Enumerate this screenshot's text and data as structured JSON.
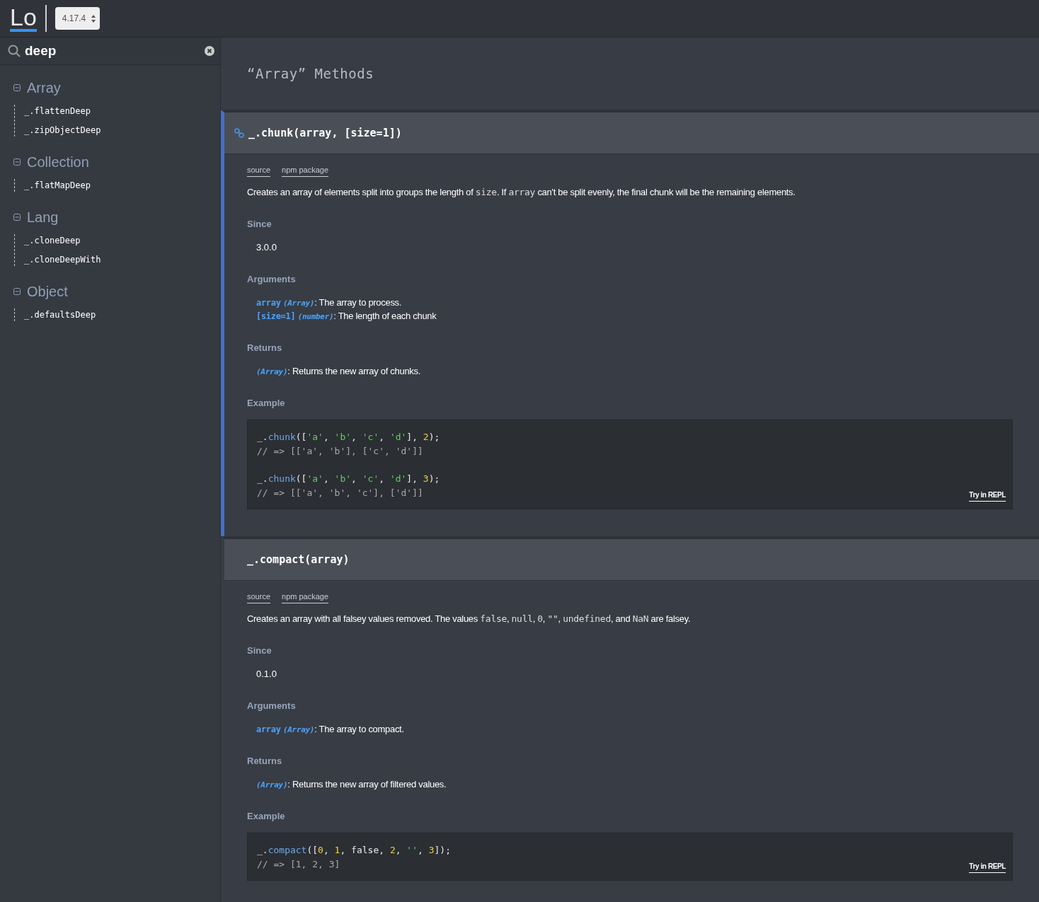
{
  "header": {
    "logo": "Lo",
    "version": "4.17.4"
  },
  "search": {
    "value": "deep"
  },
  "sidebar": {
    "groups": [
      {
        "title": "Array",
        "expanded": true,
        "items": [
          "_.flattenDeep",
          "_.zipObjectDeep"
        ]
      },
      {
        "title": "Collection",
        "expanded": true,
        "items": [
          "_.flatMapDeep"
        ]
      },
      {
        "title": "Lang",
        "expanded": true,
        "items": [
          "_.cloneDeep",
          "_.cloneDeepWith"
        ]
      },
      {
        "title": "Object",
        "expanded": true,
        "items": [
          "_.defaultsDeep"
        ]
      }
    ]
  },
  "page_title": "“Array” Methods",
  "methods": [
    {
      "signature": "_.chunk(array, [size=1])",
      "selected": true,
      "links": [
        "source",
        "npm package"
      ],
      "description": [
        {
          "kind": "text",
          "text": "Creates an array of elements split into groups the length of "
        },
        {
          "kind": "code",
          "text": "size"
        },
        {
          "kind": "text",
          "text": ". If "
        },
        {
          "kind": "code",
          "text": "array"
        },
        {
          "kind": "text",
          "text": " can't be split evenly, the final chunk will be the remaining elements."
        }
      ],
      "since_label": "Since",
      "since": "3.0.0",
      "arguments_label": "Arguments",
      "arguments": [
        {
          "name": "array",
          "type": "(Array)",
          "text": ": The array to process."
        },
        {
          "name": "[size=1]",
          "type": "(number)",
          "text": ": The length of each chunk"
        }
      ],
      "returns_label": "Returns",
      "returns": {
        "type": "(Array)",
        "text": ": Returns the new array of chunks."
      },
      "example_label": "Example",
      "repl": "Try in REPL",
      "example": [
        [
          [
            {
              "kind": "plain",
              "text": "_."
            },
            {
              "kind": "fn",
              "text": "chunk"
            },
            {
              "kind": "plain",
              "text": "(["
            },
            {
              "kind": "str",
              "text": "'a'"
            },
            {
              "kind": "plain",
              "text": ", "
            },
            {
              "kind": "str",
              "text": "'b'"
            },
            {
              "kind": "plain",
              "text": ", "
            },
            {
              "kind": "str",
              "text": "'c'"
            },
            {
              "kind": "plain",
              "text": ", "
            },
            {
              "kind": "str",
              "text": "'d'"
            },
            {
              "kind": "plain",
              "text": "], "
            },
            {
              "kind": "num",
              "text": "2"
            },
            {
              "kind": "plain",
              "text": ");"
            }
          ],
          [
            {
              "kind": "comment",
              "text": "// => [['a', 'b'], ['c', 'd']]"
            }
          ]
        ],
        [
          [
            {
              "kind": "plain",
              "text": "_."
            },
            {
              "kind": "fn",
              "text": "chunk"
            },
            {
              "kind": "plain",
              "text": "(["
            },
            {
              "kind": "str",
              "text": "'a'"
            },
            {
              "kind": "plain",
              "text": ", "
            },
            {
              "kind": "str",
              "text": "'b'"
            },
            {
              "kind": "plain",
              "text": ", "
            },
            {
              "kind": "str",
              "text": "'c'"
            },
            {
              "kind": "plain",
              "text": ", "
            },
            {
              "kind": "str",
              "text": "'d'"
            },
            {
              "kind": "plain",
              "text": "], "
            },
            {
              "kind": "num",
              "text": "3"
            },
            {
              "kind": "plain",
              "text": ");"
            }
          ],
          [
            {
              "kind": "comment",
              "text": "// => [['a', 'b', 'c'], ['d']]"
            }
          ]
        ]
      ]
    },
    {
      "signature": "_.compact(array)",
      "selected": false,
      "links": [
        "source",
        "npm package"
      ],
      "description": [
        {
          "kind": "text",
          "text": "Creates an array with all falsey values removed. The values "
        },
        {
          "kind": "code",
          "text": "false"
        },
        {
          "kind": "text",
          "text": ", "
        },
        {
          "kind": "code",
          "text": "null"
        },
        {
          "kind": "text",
          "text": ", "
        },
        {
          "kind": "code",
          "text": "0"
        },
        {
          "kind": "text",
          "text": ", "
        },
        {
          "kind": "code",
          "text": "\"\""
        },
        {
          "kind": "text",
          "text": ", "
        },
        {
          "kind": "code",
          "text": "undefined"
        },
        {
          "kind": "text",
          "text": ", and "
        },
        {
          "kind": "code",
          "text": "NaN"
        },
        {
          "kind": "text",
          "text": " are falsey."
        }
      ],
      "since_label": "Since",
      "since": "0.1.0",
      "arguments_label": "Arguments",
      "arguments": [
        {
          "name": "array",
          "type": "(Array)",
          "text": ": The array to compact."
        }
      ],
      "returns_label": "Returns",
      "returns": {
        "type": "(Array)",
        "text": ": Returns the new array of filtered values."
      },
      "example_label": "Example",
      "repl": "Try in REPL",
      "example": [
        [
          [
            {
              "kind": "plain",
              "text": "_."
            },
            {
              "kind": "fn",
              "text": "compact"
            },
            {
              "kind": "plain",
              "text": "(["
            },
            {
              "kind": "num",
              "text": "0"
            },
            {
              "kind": "plain",
              "text": ", "
            },
            {
              "kind": "num",
              "text": "1"
            },
            {
              "kind": "plain",
              "text": ", false, "
            },
            {
              "kind": "num",
              "text": "2"
            },
            {
              "kind": "plain",
              "text": ", "
            },
            {
              "kind": "str",
              "text": "''"
            },
            {
              "kind": "plain",
              "text": ", "
            },
            {
              "kind": "num",
              "text": "3"
            },
            {
              "kind": "plain",
              "text": "]);"
            }
          ],
          [
            {
              "kind": "comment",
              "text": "// => [1, 2, 3]"
            }
          ]
        ]
      ]
    }
  ]
}
